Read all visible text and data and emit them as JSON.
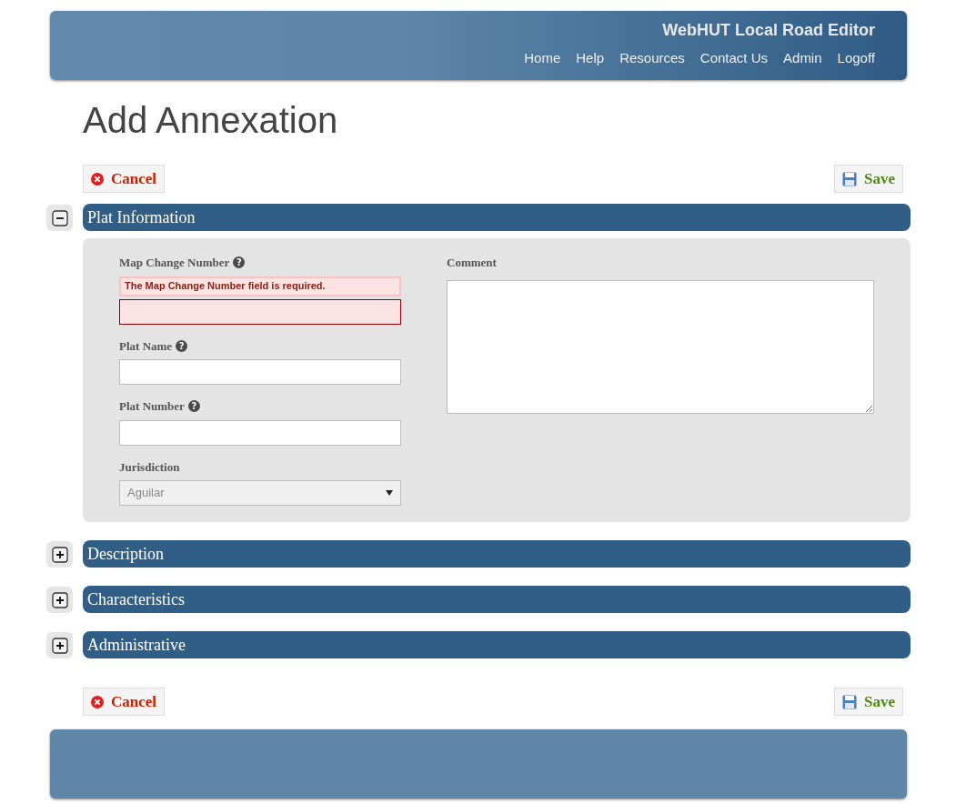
{
  "header": {
    "app_title": "WebHUT Local Road Editor",
    "nav": [
      "Home",
      "Help",
      "Resources",
      "Contact Us",
      "Admin",
      "Logoff"
    ]
  },
  "page_title": "Add Annexation",
  "top_actions": {
    "cancel": "Cancel",
    "save": "Save"
  },
  "sections": [
    {
      "title": "Plat Information",
      "expanded": true,
      "fields": [
        {
          "kind": "text",
          "label": "Map Change Number",
          "help_mark": "?",
          "error": "The Map Change Number field is required."
        },
        {
          "kind": "text",
          "label": "Plat Name",
          "help_mark": "?"
        },
        {
          "kind": "text",
          "label": "Plat Number",
          "help_mark": "?"
        },
        {
          "kind": "select",
          "label": "Jurisdiction",
          "value": "Aguilar"
        }
      ],
      "comment_label": "Comment"
    },
    {
      "title": "Description",
      "expanded": false
    },
    {
      "title": "Characteristics",
      "expanded": false
    },
    {
      "title": "Administrative",
      "expanded": false
    }
  ],
  "bottom_actions": {
    "cancel": "Cancel",
    "save": "Save"
  }
}
